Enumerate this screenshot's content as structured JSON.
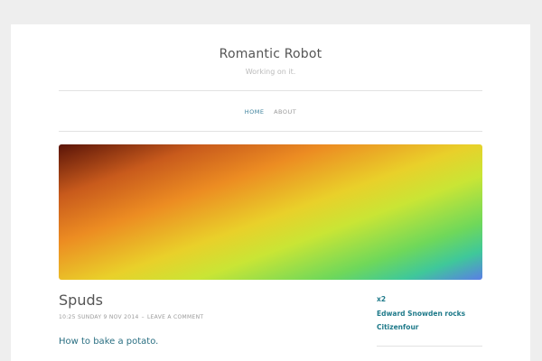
{
  "site": {
    "title": "Romantic Robot",
    "description": "Working on it."
  },
  "nav": {
    "items": [
      {
        "label": "HOME",
        "active": true
      },
      {
        "label": "ABOUT",
        "active": false
      }
    ]
  },
  "post": {
    "title": "Spuds",
    "time": "10:25 SUNDAY 9 NOV 2014",
    "separator": "–",
    "comment_link": "LEAVE A COMMENT",
    "body_link": "How to bake a potato."
  },
  "sidebar": {
    "links": [
      "x2",
      "Edward Snowden rocks",
      "Citizenfour"
    ]
  },
  "colors": {
    "accent": "#3a7f9a",
    "link": "#1f7a8a",
    "background": "#eeeeee"
  }
}
